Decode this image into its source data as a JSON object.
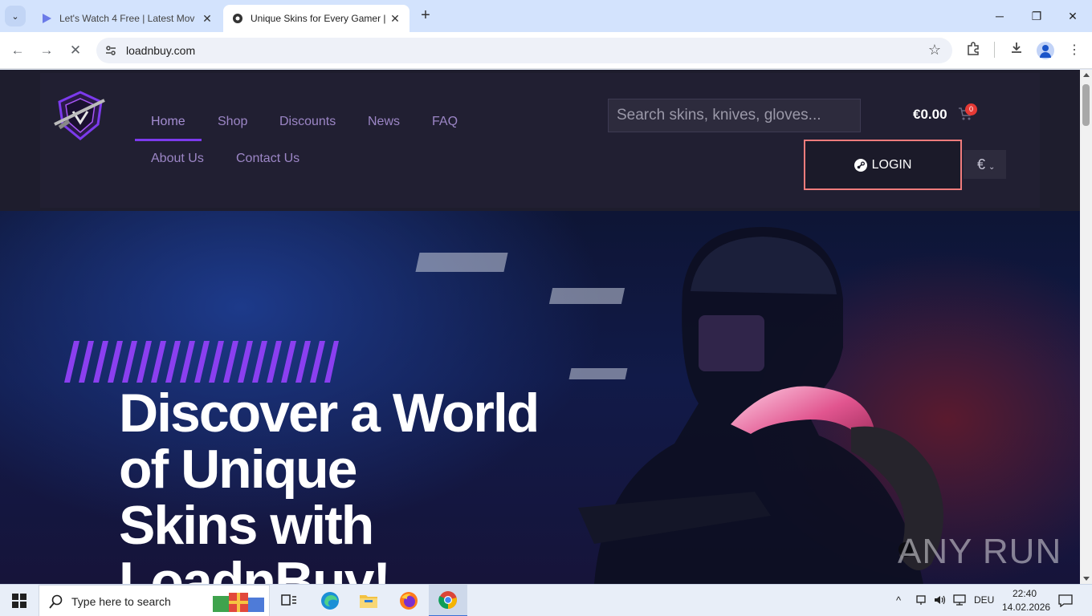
{
  "browser": {
    "tabs": [
      {
        "title": "Let's Watch 4 Free | Latest Mov",
        "active": false
      },
      {
        "title": "Unique Skins for Every Gamer |",
        "active": true
      }
    ],
    "url": "loadnbuy.com"
  },
  "site": {
    "nav": {
      "row1": [
        "Home",
        "Shop",
        "Discounts",
        "News",
        "FAQ"
      ],
      "row2": [
        "About Us",
        "Contact Us"
      ]
    },
    "search_placeholder": "Search skins, knives, gloves...",
    "cart": {
      "total": "€0.00",
      "count": "0"
    },
    "login_label": "LOGIN",
    "currency": "€",
    "hero_title": "Discover a World\nof Unique\nSkins with\nLoadnBuy!",
    "watermark": "ANY RUN"
  },
  "taskbar": {
    "search_placeholder": "Type here to search",
    "language": "DEU",
    "time": "22:40",
    "date": "14.02.2026"
  },
  "colors": {
    "accent": "#7c3aed",
    "login_border": "#f07c7c",
    "cart_badge": "#e53935"
  }
}
